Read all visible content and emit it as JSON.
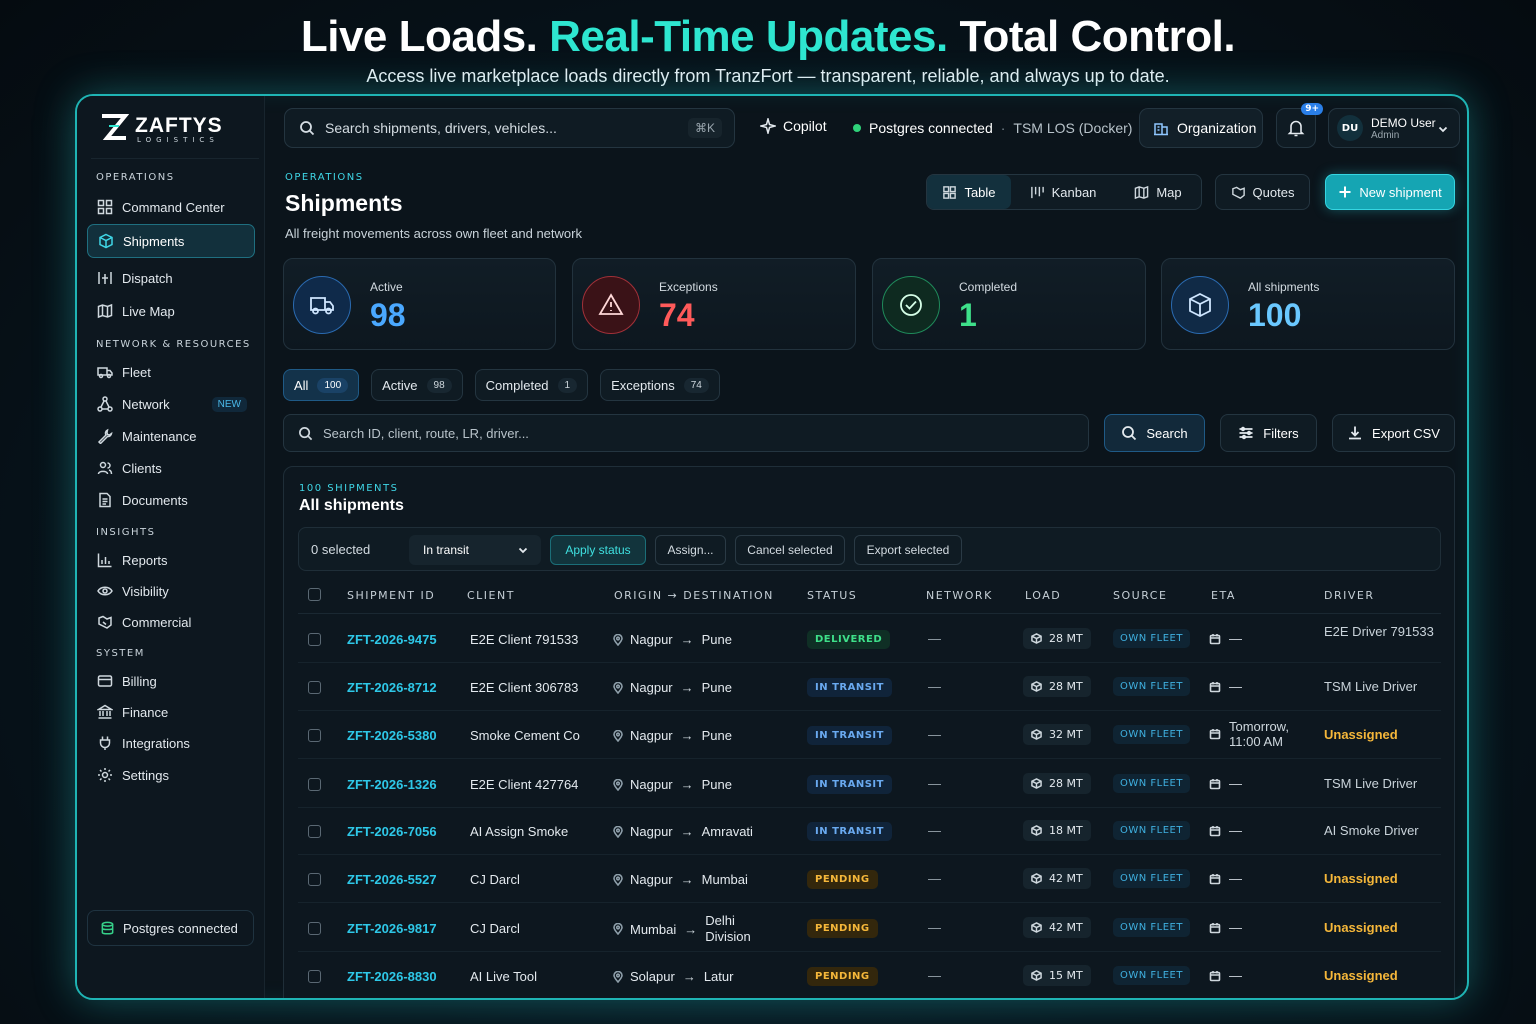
{
  "hero": {
    "title_part1": "Live Loads.",
    "title_part2": "Real-Time Updates.",
    "title_part3": "Total Control.",
    "subtitle": "Access live marketplace loads directly from TranzFort — transparent, reliable, and always up to date."
  },
  "brand": {
    "name": "ZAFTYS",
    "tagline": "LOGISTICS"
  },
  "sidebar": {
    "sections": {
      "operations": "OPERATIONS",
      "network": "NETWORK & RESOURCES",
      "insights": "INSIGHTS",
      "system": "SYSTEM"
    },
    "items": {
      "command_center": "Command Center",
      "shipments": "Shipments",
      "dispatch": "Dispatch",
      "live_map": "Live Map",
      "fleet": "Fleet",
      "network": "Network",
      "network_badge": "NEW",
      "maintenance": "Maintenance",
      "clients": "Clients",
      "documents": "Documents",
      "reports": "Reports",
      "visibility": "Visibility",
      "commercial": "Commercial",
      "billing": "Billing",
      "finance": "Finance",
      "integrations": "Integrations",
      "settings": "Settings"
    },
    "status": "Postgres connected"
  },
  "topbar": {
    "search_placeholder": "Search shipments, drivers, vehicles...",
    "shortcut": "⌘K",
    "copilot": "Copilot",
    "db_status": "Postgres connected",
    "db_env": "TSM LOS (Docker)",
    "organization": "Organization",
    "notif_count": "9+",
    "user_initials": "DU",
    "user_name": "DEMO User",
    "user_role": "Admin"
  },
  "page": {
    "breadcrumb": "OPERATIONS",
    "title": "Shipments",
    "subtitle": "All freight movements across own fleet and network",
    "views": {
      "table": "Table",
      "kanban": "Kanban",
      "map": "Map"
    },
    "quotes": "Quotes",
    "new_shipment": "New shipment"
  },
  "stats": {
    "active": {
      "label": "Active",
      "value": "98"
    },
    "exceptions": {
      "label": "Exceptions",
      "value": "74"
    },
    "completed": {
      "label": "Completed",
      "value": "1"
    },
    "all": {
      "label": "All shipments",
      "value": "100"
    }
  },
  "filters": {
    "all": {
      "label": "All",
      "count": "100"
    },
    "active": {
      "label": "Active",
      "count": "98"
    },
    "completed": {
      "label": "Completed",
      "count": "1"
    },
    "exceptions": {
      "label": "Exceptions",
      "count": "74"
    }
  },
  "toolbar": {
    "search_placeholder": "Search ID, client, route, LR, driver...",
    "search": "Search",
    "filters": "Filters",
    "export": "Export CSV"
  },
  "table": {
    "count_label": "100 SHIPMENTS",
    "title": "All shipments",
    "selected": "0 selected",
    "status_select": "In transit",
    "apply": "Apply status",
    "assign": "Assign...",
    "cancel": "Cancel selected",
    "export_selected": "Export selected",
    "columns": {
      "id": "SHIPMENT ID",
      "client": "CLIENT",
      "route": "ORIGIN → DESTINATION",
      "status": "STATUS",
      "network": "NETWORK",
      "load": "LOAD",
      "source": "SOURCE",
      "eta": "ETA",
      "driver": "DRIVER"
    },
    "rows": [
      {
        "id": "ZFT-2026-9475",
        "client": "E2E Client 791533",
        "origin": "Nagpur",
        "arrow": "→",
        "dest": "Pune",
        "status": "DELIVERED",
        "status_kind": "delivered",
        "network": "—",
        "load": "28 MT",
        "source": "OWN FLEET",
        "eta": "—",
        "driver": "E2E Driver 791533",
        "driver_kind": "normal"
      },
      {
        "id": "ZFT-2026-8712",
        "client": "E2E Client 306783",
        "origin": "Nagpur",
        "arrow": "→",
        "dest": "Pune",
        "status": "IN TRANSIT",
        "status_kind": "transit",
        "network": "—",
        "load": "28 MT",
        "source": "OWN FLEET",
        "eta": "—",
        "driver": "TSM Live Driver",
        "driver_kind": "normal"
      },
      {
        "id": "ZFT-2026-5380",
        "client": "Smoke Cement Co",
        "origin": "Nagpur",
        "arrow": "→",
        "dest": "Pune",
        "status": "IN TRANSIT",
        "status_kind": "transit",
        "network": "—",
        "load": "32 MT",
        "source": "OWN FLEET",
        "eta": "Tomorrow, 11:00 AM",
        "driver": "Unassigned",
        "driver_kind": "unassigned"
      },
      {
        "id": "ZFT-2026-1326",
        "client": "E2E Client 427764",
        "origin": "Nagpur",
        "arrow": "→",
        "dest": "Pune",
        "status": "IN TRANSIT",
        "status_kind": "transit",
        "network": "—",
        "load": "28 MT",
        "source": "OWN FLEET",
        "eta": "—",
        "driver": "TSM Live Driver",
        "driver_kind": "normal"
      },
      {
        "id": "ZFT-2026-7056",
        "client": "AI Assign Smoke",
        "origin": "Nagpur",
        "arrow": "→",
        "dest": "Amravati",
        "status": "IN TRANSIT",
        "status_kind": "transit",
        "network": "—",
        "load": "18 MT",
        "source": "OWN FLEET",
        "eta": "—",
        "driver": "AI Smoke Driver",
        "driver_kind": "normal"
      },
      {
        "id": "ZFT-2026-5527",
        "client": "CJ Darcl",
        "origin": "Nagpur",
        "arrow": "→",
        "dest": "Mumbai",
        "status": "PENDING",
        "status_kind": "pending",
        "network": "—",
        "load": "42 MT",
        "source": "OWN FLEET",
        "eta": "—",
        "driver": "Unassigned",
        "driver_kind": "unassigned"
      },
      {
        "id": "ZFT-2026-9817",
        "client": "CJ Darcl",
        "origin": "Mumbai",
        "arrow": "→",
        "dest": "Delhi Division",
        "status": "PENDING",
        "status_kind": "pending",
        "network": "—",
        "load": "42 MT",
        "source": "OWN FLEET",
        "eta": "—",
        "driver": "Unassigned",
        "driver_kind": "unassigned"
      },
      {
        "id": "ZFT-2026-8830",
        "client": "AI Live Tool",
        "origin": "Solapur",
        "arrow": "→",
        "dest": "Latur",
        "status": "PENDING",
        "status_kind": "pending",
        "network": "—",
        "load": "15 MT",
        "source": "OWN FLEET",
        "eta": "—",
        "driver": "Unassigned",
        "driver_kind": "unassigned"
      }
    ]
  },
  "colors": {
    "accent": "#2ee6d0",
    "primary_button": "#15a5b3",
    "delivered": "#3ee08a",
    "transit": "#6aaaf0",
    "pending": "#f5b73a",
    "exception": "#ff5a5a",
    "active": "#4aa8ff"
  },
  "icons": {
    "stats": [
      "truck-icon",
      "warning-icon",
      "check-circle-icon",
      "box-icon"
    ]
  }
}
